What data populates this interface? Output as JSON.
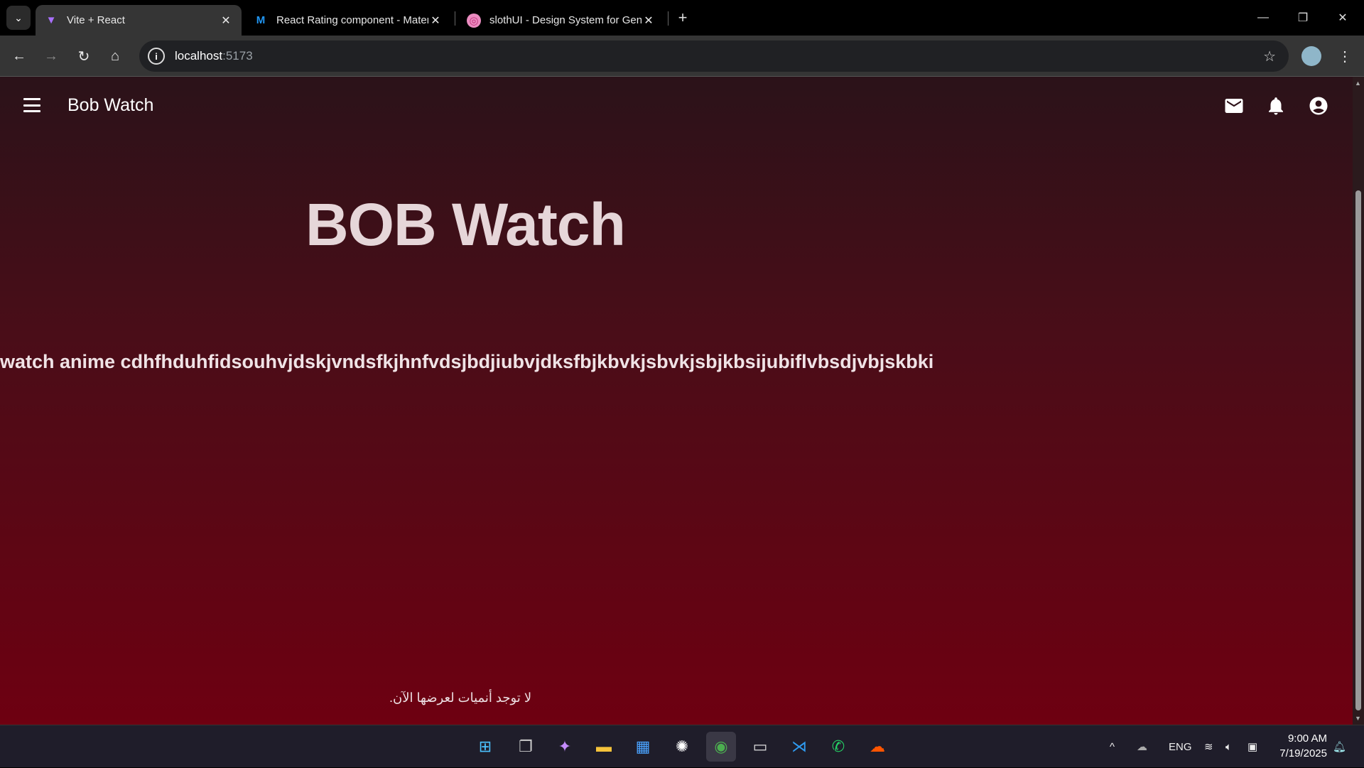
{
  "browser": {
    "tabs": [
      {
        "title": "Vite + React",
        "icon": "vite-icon",
        "active": true
      },
      {
        "title": "React Rating component - Material UI",
        "icon": "mui-icon",
        "active": false
      },
      {
        "title": "slothUI - Design System for Generative AI",
        "icon": "dribbble-icon",
        "active": false
      }
    ],
    "url_host": "localhost",
    "url_port": ":5173"
  },
  "app": {
    "brand": "Bob Watch",
    "title": "BOB Watch",
    "description": "watch anime cdhfhduhfidsouhvjdskjvndsfkjhnfvdsjbdjiubvjdksfbjkbvkjsbvkjsbjkbsijubiflvbsdjvbjskbki",
    "empty_message": "لا توجد أنميات لعرضها الآن.",
    "colors": {
      "gradient_top": "#2b1219",
      "gradient_bottom": "#6e0011"
    }
  },
  "taskbar": {
    "apps": [
      "windows-start",
      "task-view",
      "copilot",
      "file-explorer",
      "microsoft-store",
      "chatgpt",
      "chrome",
      "terminal",
      "vscode",
      "whatsapp",
      "soundcloud"
    ],
    "language": "ENG",
    "time": "9:00 AM",
    "date": "7/19/2025"
  }
}
